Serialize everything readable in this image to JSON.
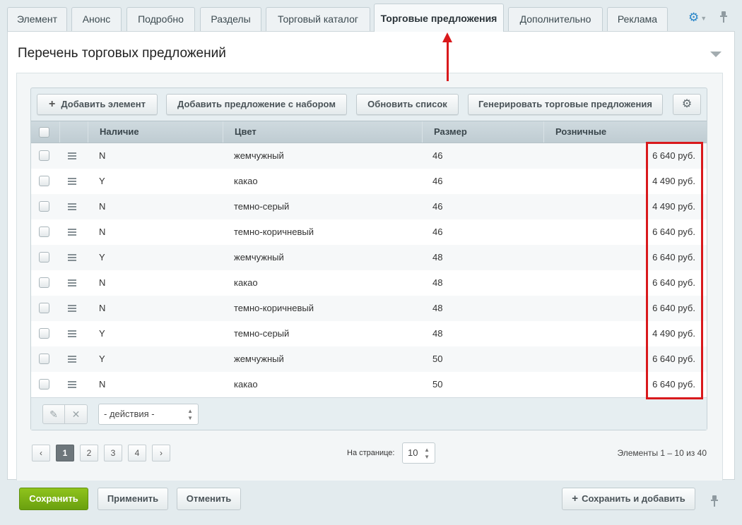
{
  "tabs": [
    {
      "label": "Элемент"
    },
    {
      "label": "Анонс"
    },
    {
      "label": "Подробно"
    },
    {
      "label": "Разделы"
    },
    {
      "label": "Торговый каталог"
    },
    {
      "label": "Торговые предложения",
      "active": true
    },
    {
      "label": "Дополнительно"
    },
    {
      "label": "Реклама"
    }
  ],
  "section": {
    "title": "Перечень торговых предложений"
  },
  "toolbar": {
    "add_element": "Добавить элемент",
    "add_offer_set": "Добавить предложение с набором",
    "refresh": "Обновить список",
    "generate": "Генерировать торговые предложения"
  },
  "table": {
    "columns": [
      "Наличие",
      "Цвет",
      "Размер",
      "Розничные"
    ],
    "rows": [
      {
        "availability": "N",
        "color": "жемчужный",
        "size": "46",
        "price": "6 640 руб."
      },
      {
        "availability": "Y",
        "color": "какао",
        "size": "46",
        "price": "4 490 руб."
      },
      {
        "availability": "N",
        "color": "темно-серый",
        "size": "46",
        "price": "4 490 руб."
      },
      {
        "availability": "N",
        "color": "темно-коричневый",
        "size": "46",
        "price": "6 640 руб."
      },
      {
        "availability": "Y",
        "color": "жемчужный",
        "size": "48",
        "price": "6 640 руб."
      },
      {
        "availability": "N",
        "color": "какао",
        "size": "48",
        "price": "6 640 руб."
      },
      {
        "availability": "N",
        "color": "темно-коричневый",
        "size": "48",
        "price": "6 640 руб."
      },
      {
        "availability": "Y",
        "color": "темно-серый",
        "size": "48",
        "price": "4 490 руб."
      },
      {
        "availability": "Y",
        "color": "жемчужный",
        "size": "50",
        "price": "6 640 руб."
      },
      {
        "availability": "N",
        "color": "какао",
        "size": "50",
        "price": "6 640 руб."
      }
    ]
  },
  "actions": {
    "selected": "- действия -"
  },
  "pagination": {
    "pages": [
      "1",
      "2",
      "3",
      "4"
    ],
    "current": "1",
    "prev": "‹",
    "next": "›",
    "per_page_label": "На странице:",
    "per_page_value": "10",
    "count_label": "Элементы 1 – 10 из 40"
  },
  "footer": {
    "save": "Сохранить",
    "apply": "Применить",
    "cancel": "Отменить",
    "save_and_add": "Сохранить и добавить"
  },
  "colors": {
    "accent": "#2a86c8",
    "primary_button": "#7ab317",
    "annotation": "#d9191c"
  },
  "icons": {
    "settings": "gear-icon",
    "pin": "pin-icon",
    "collapse": "chevron-down-icon",
    "edit": "pencil-icon",
    "delete": "close-icon",
    "drag": "drag-handle-icon"
  }
}
